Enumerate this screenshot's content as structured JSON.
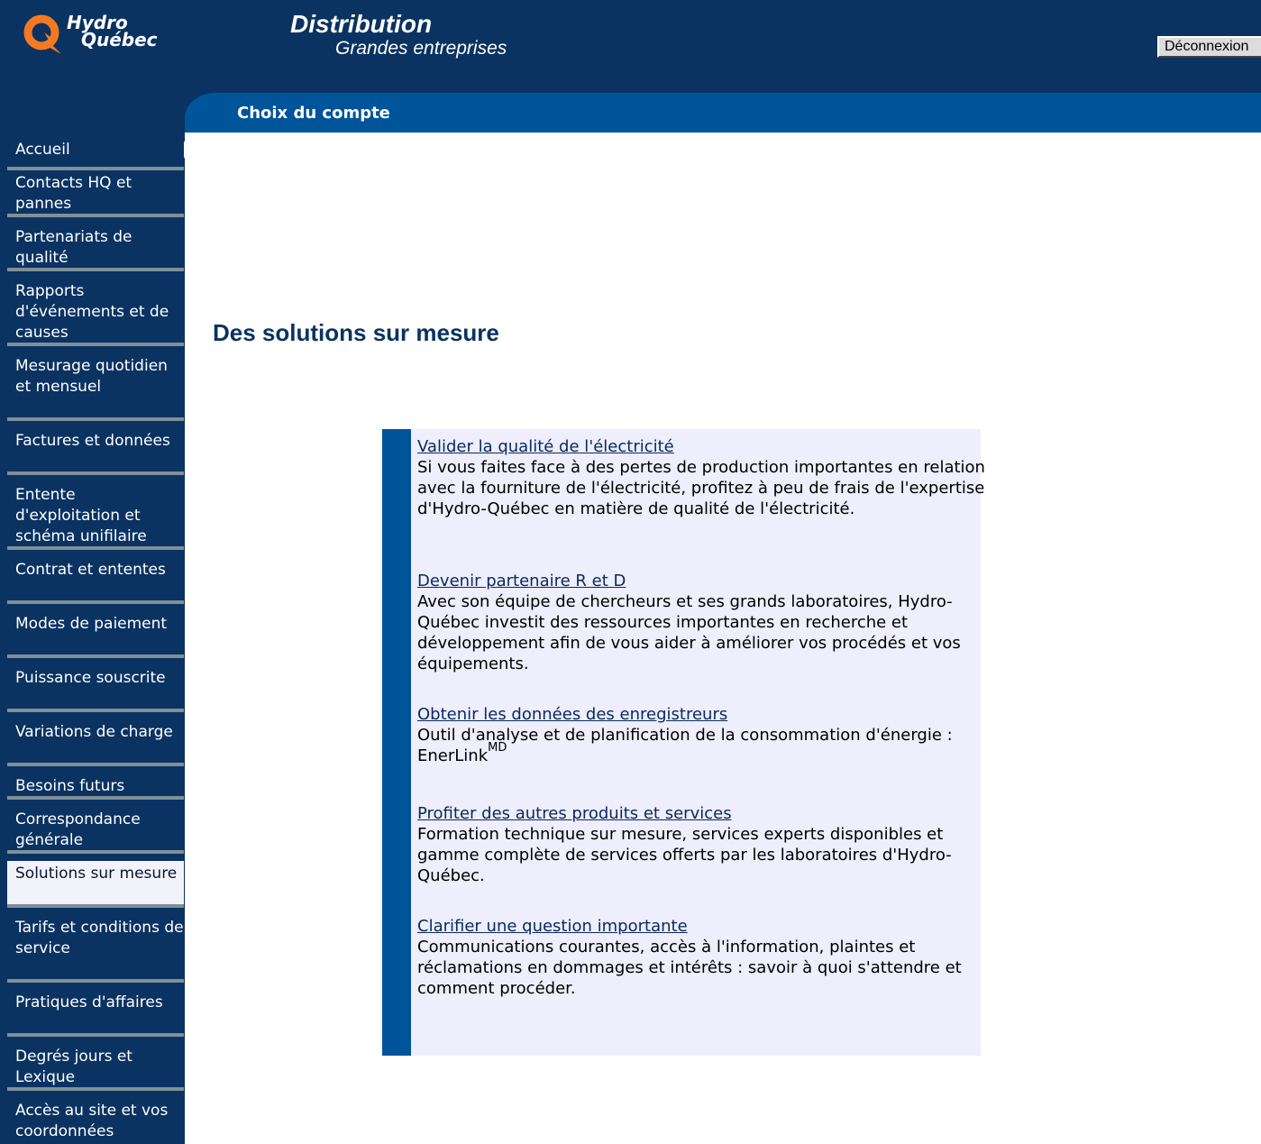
{
  "header": {
    "logo_line1": "Hydro",
    "logo_line2": "Québec",
    "brand_title": "Distribution",
    "brand_subtitle": "Grandes entreprises",
    "logout_label": "Déconnexion",
    "page_title": "Choix du compte"
  },
  "sidebar": {
    "items": [
      {
        "label": "Accueil",
        "active": false
      },
      {
        "label": "Contacts HQ et pannes",
        "active": false
      },
      {
        "label": "Partenariats de qualité",
        "active": false
      },
      {
        "label": "Rapports d'événements et de causes",
        "active": false
      },
      {
        "label": "Mesurage quotidien et mensuel",
        "active": false
      },
      {
        "label": "Factures et données",
        "active": false
      },
      {
        "label": "Entente d'exploitation et schéma unifilaire",
        "active": false
      },
      {
        "label": "Contrat et ententes",
        "active": false
      },
      {
        "label": "Modes de paiement",
        "active": false
      },
      {
        "label": "Puissance souscrite",
        "active": false
      },
      {
        "label": "Variations de charge",
        "active": false
      },
      {
        "label": "Besoins futurs",
        "active": false
      },
      {
        "label": "Correspondance générale",
        "active": false
      },
      {
        "label": "Solutions sur mesure",
        "active": true
      },
      {
        "label": "Tarifs et conditions de service",
        "active": false
      },
      {
        "label": "Pratiques d'affaires",
        "active": false
      },
      {
        "label": "Degrés jours et Lexique",
        "active": false
      },
      {
        "label": "Accès au site et vos coordonnées",
        "active": false
      }
    ]
  },
  "main": {
    "heading": "Des solutions sur mesure",
    "entries": [
      {
        "link": "Valider la qualité de l'électricité",
        "text": "Si vous faites face à des pertes de production importantes en relation avec la fourniture de l'électricité, profitez à peu de frais de l'expertise d'Hydro-Québec en matière de qualité de l'électricité."
      },
      {
        "link": "Devenir partenaire R et D",
        "text": "Avec son équipe de chercheurs et ses grands laboratoires, Hydro-Québec investit des ressources importantes en recherche et développement afin de vous aider à améliorer vos procédés et vos équipements."
      },
      {
        "link": "Obtenir les données des enregistreurs",
        "text": "Outil d'analyse et de planification de la consommation d'énergie : EnerLink",
        "sup": "MD"
      },
      {
        "link": "Profiter des autres produits et services",
        "text": "Formation technique sur mesure, services experts disponibles et gamme complète de services offerts par les laboratoires d'Hydro-Québec."
      },
      {
        "link": "Clarifier une question importante",
        "text": "Communications courantes, accès à l'information, plaintes et réclamations en dommages et intérêts : savoir à quoi s'attendre et comment procéder."
      }
    ]
  },
  "colors": {
    "navy": "#0a3362",
    "blue": "#005499",
    "panel_bg": "#eeeefc",
    "logo_orange": "#f47920"
  }
}
